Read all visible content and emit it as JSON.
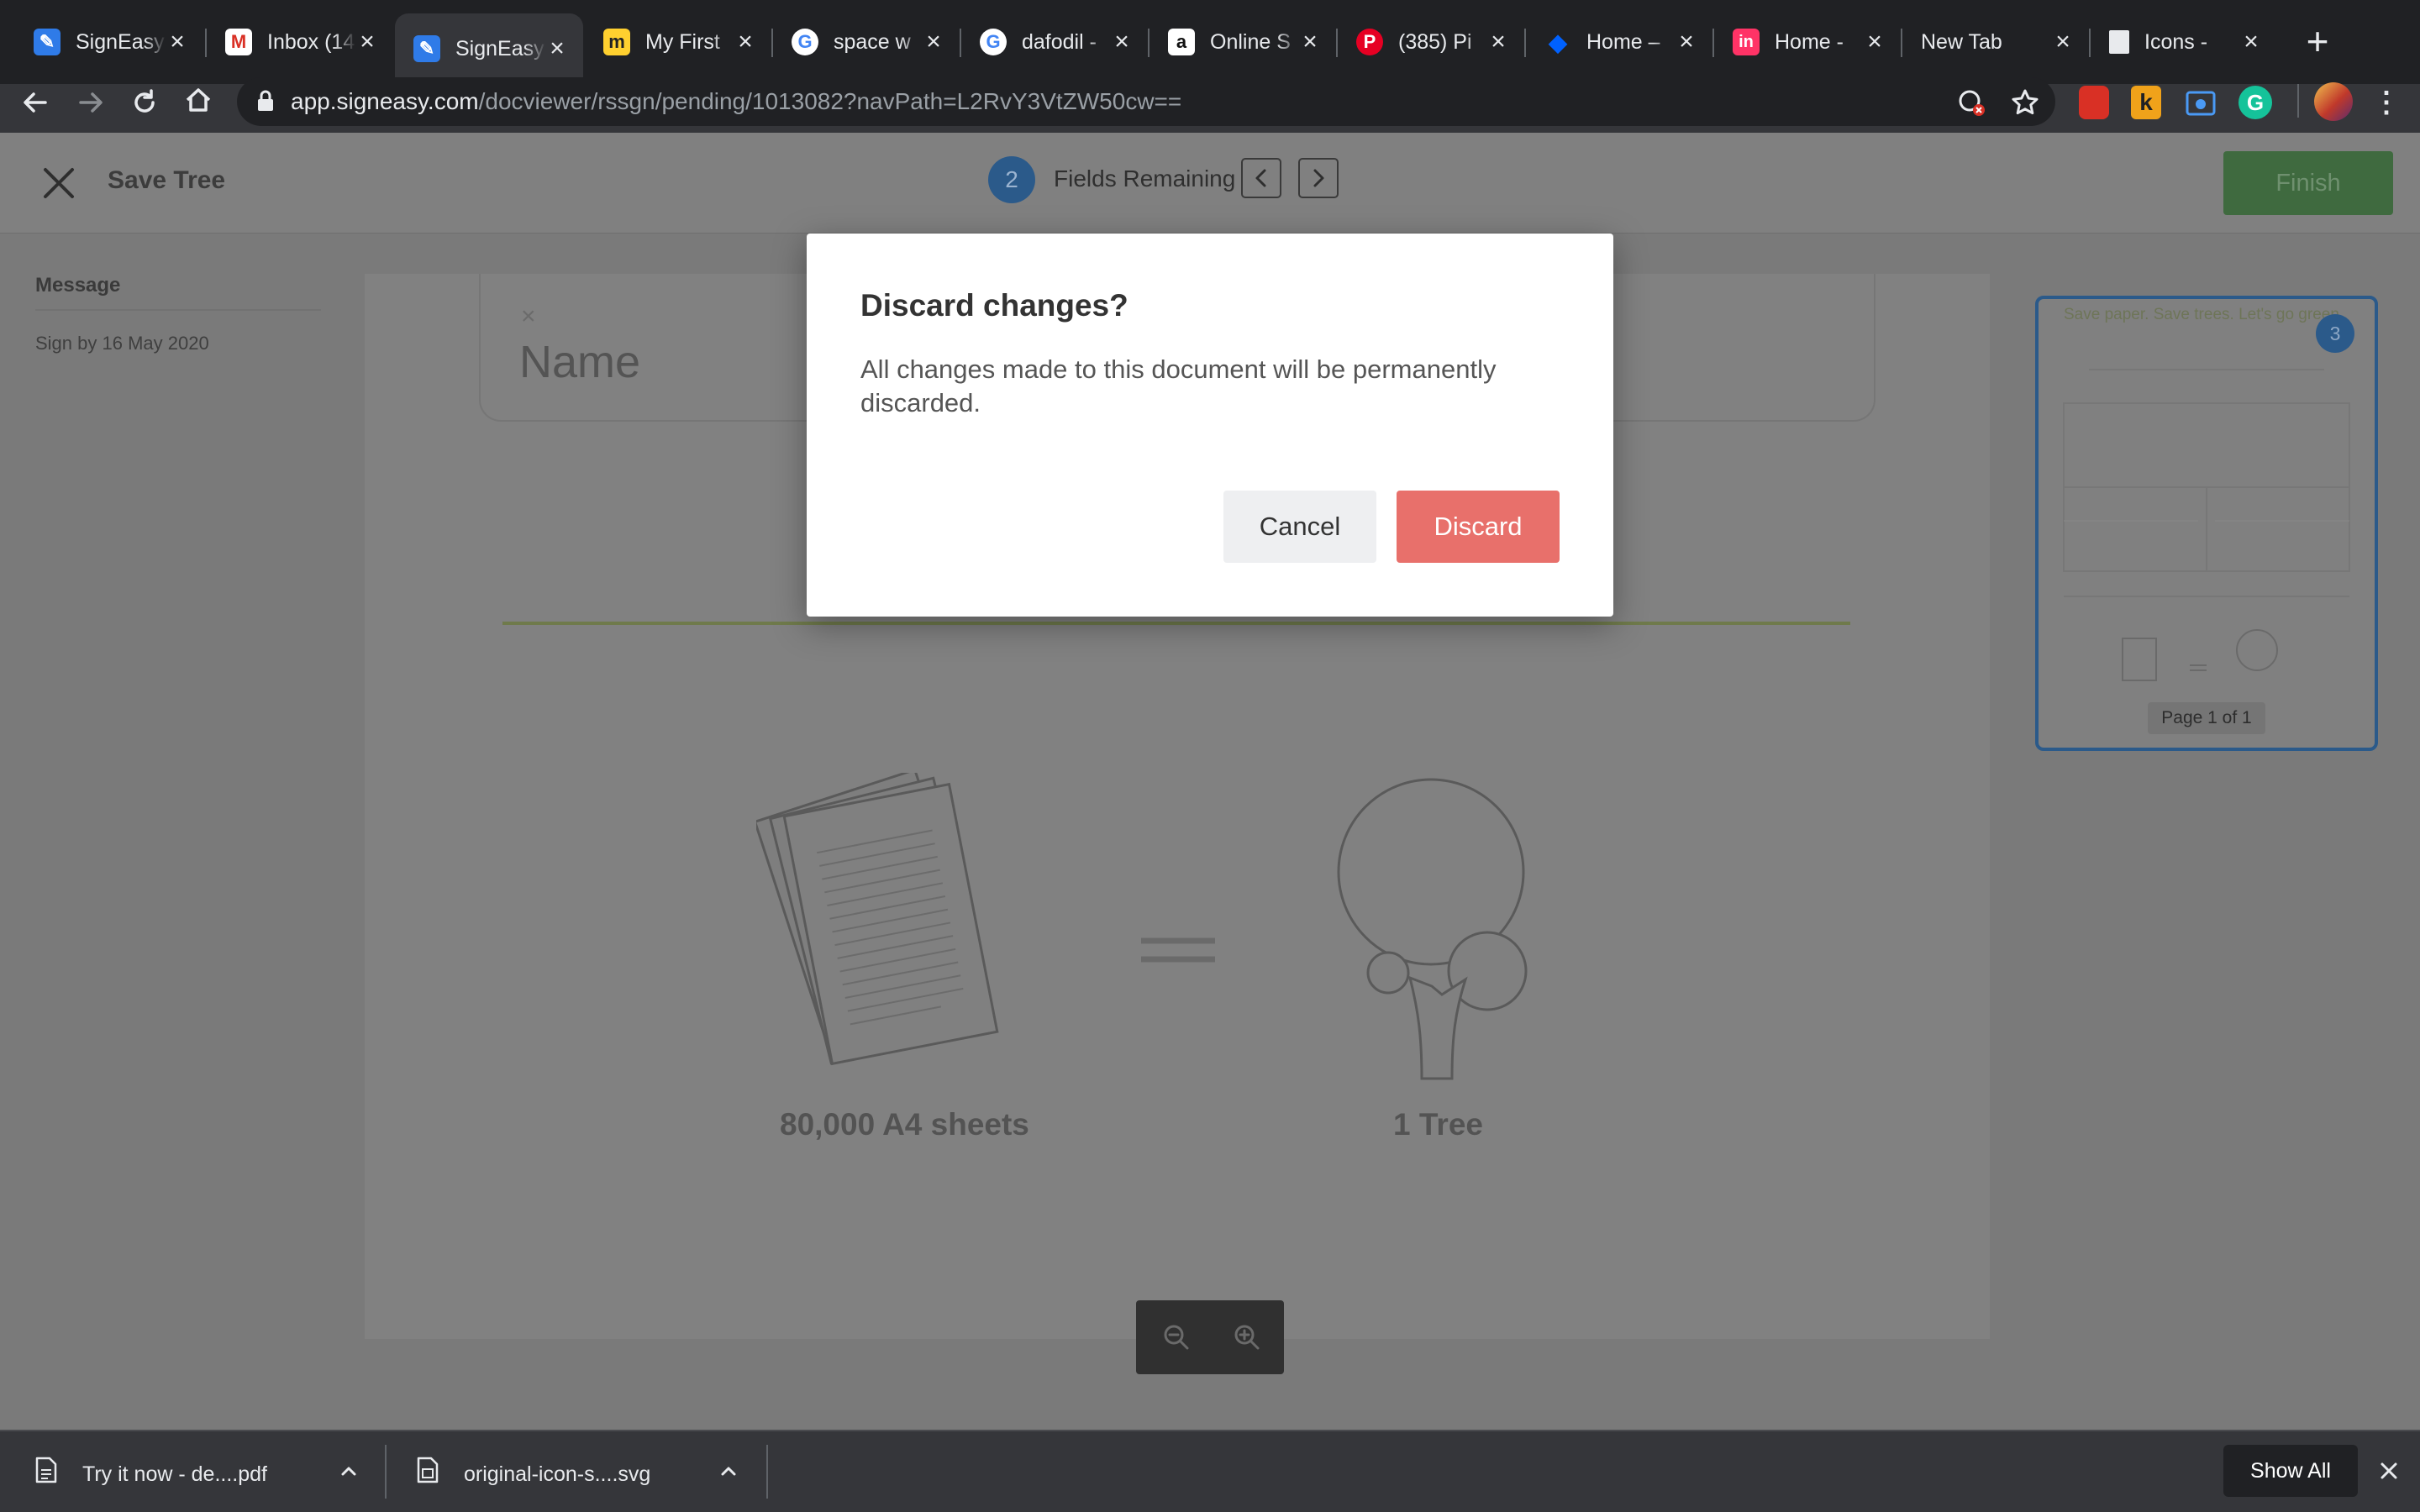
{
  "browser": {
    "tabs": [
      {
        "title": "SignEasy",
        "icon": "signeasy-icon",
        "active": false
      },
      {
        "title": "Inbox (14",
        "icon": "gmail-icon",
        "active": false
      },
      {
        "title": "SignEasy",
        "icon": "signeasy-icon",
        "active": true
      },
      {
        "title": "My First",
        "icon": "miro-icon",
        "active": false
      },
      {
        "title": "space w",
        "icon": "google-icon",
        "active": false
      },
      {
        "title": "dafodil -",
        "icon": "google-icon",
        "active": false
      },
      {
        "title": "Online S",
        "icon": "amazon-icon",
        "active": false
      },
      {
        "title": "(385) Pi",
        "icon": "pinterest-icon",
        "active": false
      },
      {
        "title": "Home –",
        "icon": "dropbox-icon",
        "active": false
      },
      {
        "title": "Home -",
        "icon": "invision-icon",
        "active": false
      },
      {
        "title": "New Tab",
        "icon": "",
        "active": false
      },
      {
        "title": "Icons -",
        "icon": "noun-project-icon",
        "active": false
      }
    ],
    "url_host": "app.signeasy.com",
    "url_path": "/docviewer/rssgn/pending/1013082?navPath=L2RvY3VtZW50cw=="
  },
  "header": {
    "doc_title": "Save Tree",
    "fields_count": "2",
    "fields_label": "Fields Remaining",
    "finish_label": "Finish"
  },
  "sidebar": {
    "message_label": "Message",
    "sign_by": "Sign by 16 May 2020"
  },
  "document": {
    "name_placeholder": "Name",
    "sheets_label": "80,000 A4 sheets",
    "tree_label": "1 Tree"
  },
  "thumbnail": {
    "title": "Save paper. Save trees. Let's go green",
    "badge": "3",
    "page_label": "Page 1 of 1"
  },
  "modal": {
    "title": "Discard changes?",
    "body": "All changes made to this document will be permanently discarded.",
    "cancel_label": "Cancel",
    "discard_label": "Discard"
  },
  "downloads": {
    "items": [
      {
        "name": "Try it now - de....pdf"
      },
      {
        "name": "original-icon-s....svg"
      }
    ],
    "show_all_label": "Show All"
  },
  "colors": {
    "discard": "#e8706b",
    "brand_blue": "#2b5a8a",
    "finish_green": "#3f6a3f"
  }
}
